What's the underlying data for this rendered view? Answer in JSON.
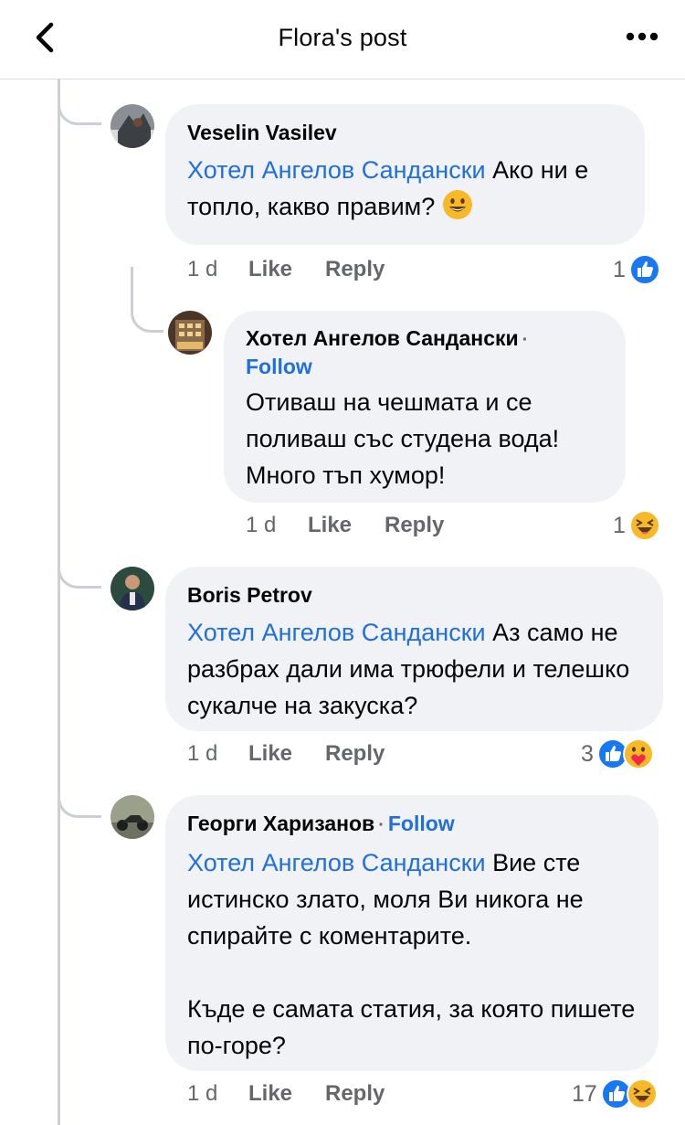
{
  "header": {
    "title": "Flora's post"
  },
  "comments": [
    {
      "author": "Veselin Vasilev",
      "mention": "Хотел Ангелов Сандански",
      "text": " Ако ни е топло, какво правим? ",
      "time": "1 d",
      "like": "Like",
      "reply": "Reply",
      "react_count": "1"
    },
    {
      "author": "Хотел Ангелов Сандански",
      "follow": "Follow",
      "text": "Отиваш на чешмата и се поливаш със студена вода! Много тъп хумор!",
      "time": "1 d",
      "like": "Like",
      "reply": "Reply",
      "react_count": "1"
    },
    {
      "author": "Boris Petrov",
      "mention": "Хотел Ангелов Сандански",
      "text": " Аз само не разбрах дали има трюфели и телешко сукалче на закуска?",
      "time": "1 d",
      "like": "Like",
      "reply": "Reply",
      "react_count": "3"
    },
    {
      "author": "Георги Харизанов",
      "follow": "Follow",
      "mention": "Хотел Ангелов Сандански",
      "text": " Вие сте истинско злато, моля Ви никога не спирайте с коментарите.",
      "text2": "Къде е самата статия, за която пишете по-горе?",
      "time": "1 d",
      "like": "Like",
      "reply": "Reply",
      "react_count": "17"
    }
  ],
  "icons": [
    "back-arrow-icon",
    "more-dots-icon",
    "like-reaction-icon",
    "haha-reaction-icon",
    "care-reaction-icon",
    "smile-emoji-icon"
  ],
  "colors": {
    "link": "#216fdb",
    "bubble": "#f0f2f5",
    "meta": "#65676b",
    "like_blue": "#1877f2",
    "emoji_yellow": "#f7b928"
  }
}
